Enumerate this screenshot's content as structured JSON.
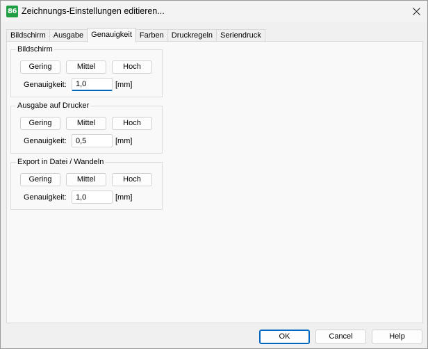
{
  "window": {
    "title": "Zeichnungs-Einstellungen editieren...",
    "app_icon_text": "86",
    "app_icon_color": "#1f9e43",
    "close_icon": "close-icon"
  },
  "tabs": [
    {
      "label": "Bildschirm",
      "active": false
    },
    {
      "label": "Ausgabe",
      "active": false
    },
    {
      "label": "Genauigkeit",
      "active": true
    },
    {
      "label": "Farben",
      "active": false
    },
    {
      "label": "Druckregeln",
      "active": false
    },
    {
      "label": "Seriendruck",
      "active": false
    }
  ],
  "groups": [
    {
      "title": "Bildschirm",
      "buttons": [
        "Gering",
        "Mittel",
        "Hoch"
      ],
      "accuracy_label": "Genauigkeit:",
      "accuracy_value": "1,0",
      "unit": "[mm]"
    },
    {
      "title": "Ausgabe auf Drucker",
      "buttons": [
        "Gering",
        "Mittel",
        "Hoch"
      ],
      "accuracy_label": "Genauigkeit:",
      "accuracy_value": "0,5",
      "unit": "[mm]"
    },
    {
      "title": "Export in Datei / Wandeln",
      "buttons": [
        "Gering",
        "Mittel",
        "Hoch"
      ],
      "accuracy_label": "Genauigkeit:",
      "accuracy_value": "1,0",
      "unit": "[mm]"
    }
  ],
  "footer": {
    "ok_label": "OK",
    "cancel_label": "Cancel",
    "help_label": "Help",
    "accent_color": "#0067c0"
  }
}
